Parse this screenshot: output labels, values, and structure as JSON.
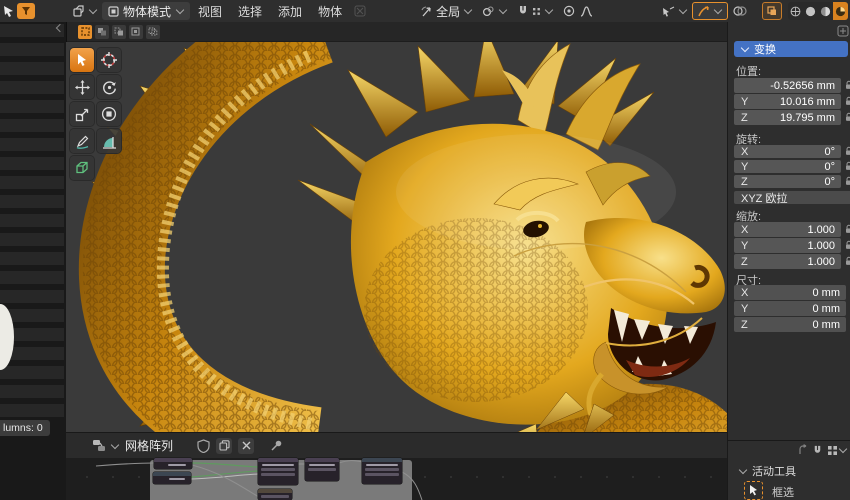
{
  "topbar": {
    "mode_label": "物体模式",
    "menu_view": "视图",
    "menu_select": "选择",
    "menu_add": "添加",
    "menu_object": "物体",
    "orientation_label": "全局"
  },
  "left_strip": {
    "status_text": "lumns: 0"
  },
  "sidebar": {
    "panel_title": "变换",
    "location_label": "位置:",
    "location": {
      "x_axis": "",
      "x": "-0.52656 mm",
      "y_axis": "Y",
      "y": "10.016 mm",
      "z_axis": "Z",
      "z": "19.795 mm"
    },
    "rotation_label": "旋转:",
    "rotation": {
      "x_axis": "X",
      "x": "0°",
      "y_axis": "Y",
      "y": "0°",
      "z_axis": "Z",
      "z": "0°"
    },
    "euler_mode": "XYZ 欧拉",
    "scale_label": "缩放:",
    "scale": {
      "x_axis": "X",
      "x": "1.000",
      "y_axis": "Y",
      "y": "1.000",
      "z_axis": "Z",
      "z": "1.000"
    },
    "dimensions_label": "尺寸:",
    "dimensions": {
      "x_axis": "X",
      "x": "0 mm",
      "y_axis": "Y",
      "y": "0 mm",
      "z_axis": "Z",
      "z": "0 mm"
    }
  },
  "node_editor": {
    "tree_name": "网格阵列"
  },
  "tool_panel": {
    "title": "活动工具",
    "active_tool": "框选"
  },
  "colors": {
    "accent_orange": "#e8912d",
    "accent_blue": "#4472c4",
    "gold": "#d99a1a"
  },
  "icons": {
    "funnel": "filter toggle",
    "mode_box": "object-mode icon",
    "orientation": "transform orientation",
    "pivot": "pivot point",
    "magnet": "snapping",
    "proportional": "proportional editing",
    "falloff": "falloff curve",
    "shading": [
      "wireframe",
      "solid",
      "material-preview",
      "rendered"
    ]
  }
}
